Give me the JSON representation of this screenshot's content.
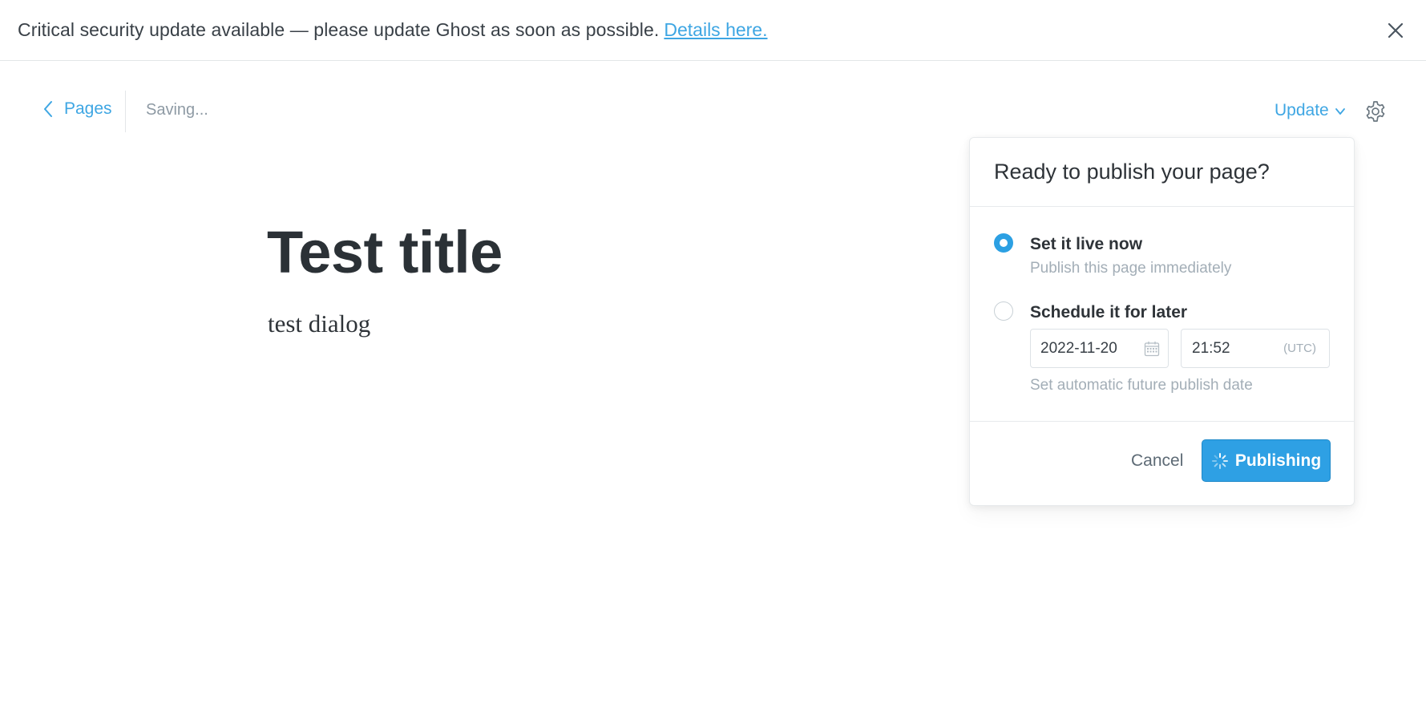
{
  "banner": {
    "message": "Critical security update available — please update Ghost as soon as possible.",
    "link_text": "Details here.",
    "close_icon": "close-icon"
  },
  "editor_header": {
    "back_label": "Pages",
    "back_icon": "chevron-left-icon",
    "status": "Saving...",
    "update_label": "Update",
    "update_icon": "chevron-down-icon",
    "settings_icon": "gear-icon"
  },
  "post": {
    "title": "Test title",
    "body": "test dialog"
  },
  "publish_panel": {
    "title": "Ready to publish your page?",
    "options": [
      {
        "label": "Set it live now",
        "description": "Publish this page immediately",
        "selected": true
      },
      {
        "label": "Schedule it for later",
        "description": "Set automatic future publish date",
        "selected": false
      }
    ],
    "date_value": "2022-11-20",
    "date_icon": "calendar-icon",
    "time_value": "21:52",
    "timezone": "(UTC)",
    "cancel_label": "Cancel",
    "publish_label": "Publishing",
    "publish_icon": "spinner-icon"
  },
  "colors": {
    "accent": "#2ea0e4",
    "link": "#3ea6e3",
    "text": "#394047",
    "muted": "#a3aeb7"
  }
}
